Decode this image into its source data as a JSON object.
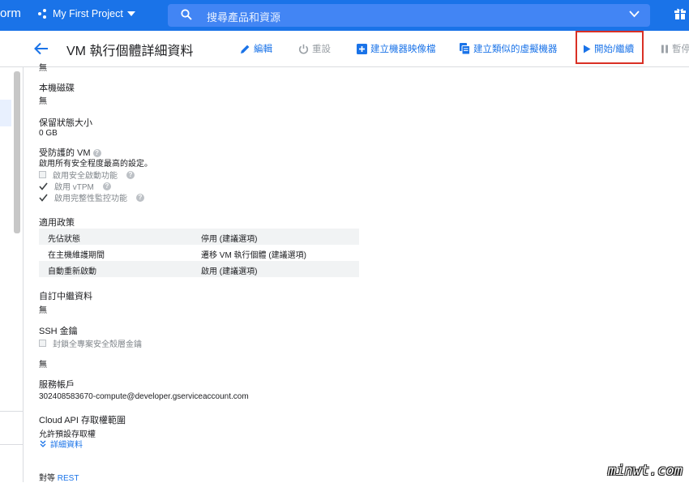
{
  "topbar": {
    "brand": "orm",
    "project": "My First Project",
    "search_placeholder": "搜尋產品和資源"
  },
  "header": {
    "title": "VM 執行個體詳細資料",
    "actions": {
      "edit": "編輯",
      "reset": "重設",
      "create_image": "建立機器映像檔",
      "create_similar": "建立類似的虛擬機器",
      "start_resume": "開始/繼續",
      "suspend": "暫停"
    }
  },
  "details": {
    "top_value": "無",
    "local_disk": {
      "label": "本機磁碟",
      "value": "無"
    },
    "reserved_state": {
      "label": "保留狀態大小",
      "value": "0 GB"
    },
    "shielded_vm": {
      "label": "受防護的 VM",
      "description": "啟用所有安全程度最高的設定。",
      "options": [
        {
          "label": "啟用安全啟動功能",
          "checked": false
        },
        {
          "label": "啟用 vTPM",
          "checked": true
        },
        {
          "label": "啟用完整性監控功能",
          "checked": true
        }
      ]
    },
    "policy": {
      "label": "適用政策",
      "rows": [
        {
          "name": "先佔狀態",
          "value": "停用 (建議選項)"
        },
        {
          "name": "在主機維護期間",
          "value": "遷移 VM 執行個體 (建議選項)"
        },
        {
          "name": "自動重新啟動",
          "value": "啟用 (建議選項)"
        }
      ]
    },
    "custom_metadata": {
      "label": "自訂中繼資料",
      "value": "無"
    },
    "ssh": {
      "label": "SSH 金鑰",
      "block_label": "封鎖全專案安全殼層金鑰",
      "value": "無"
    },
    "service_account": {
      "label": "服務帳戶",
      "value": "302408583670-compute@developer.gserviceaccount.com"
    },
    "cloud_api": {
      "label": "Cloud API 存取權範圍",
      "value": "允許預設存取權",
      "details_link": "詳細資料"
    },
    "equivalent": {
      "label": "對等",
      "link": "REST"
    }
  },
  "watermark": "minwt.com",
  "colors": {
    "primary": "#1a73e8",
    "highlight_border": "#d93025"
  }
}
